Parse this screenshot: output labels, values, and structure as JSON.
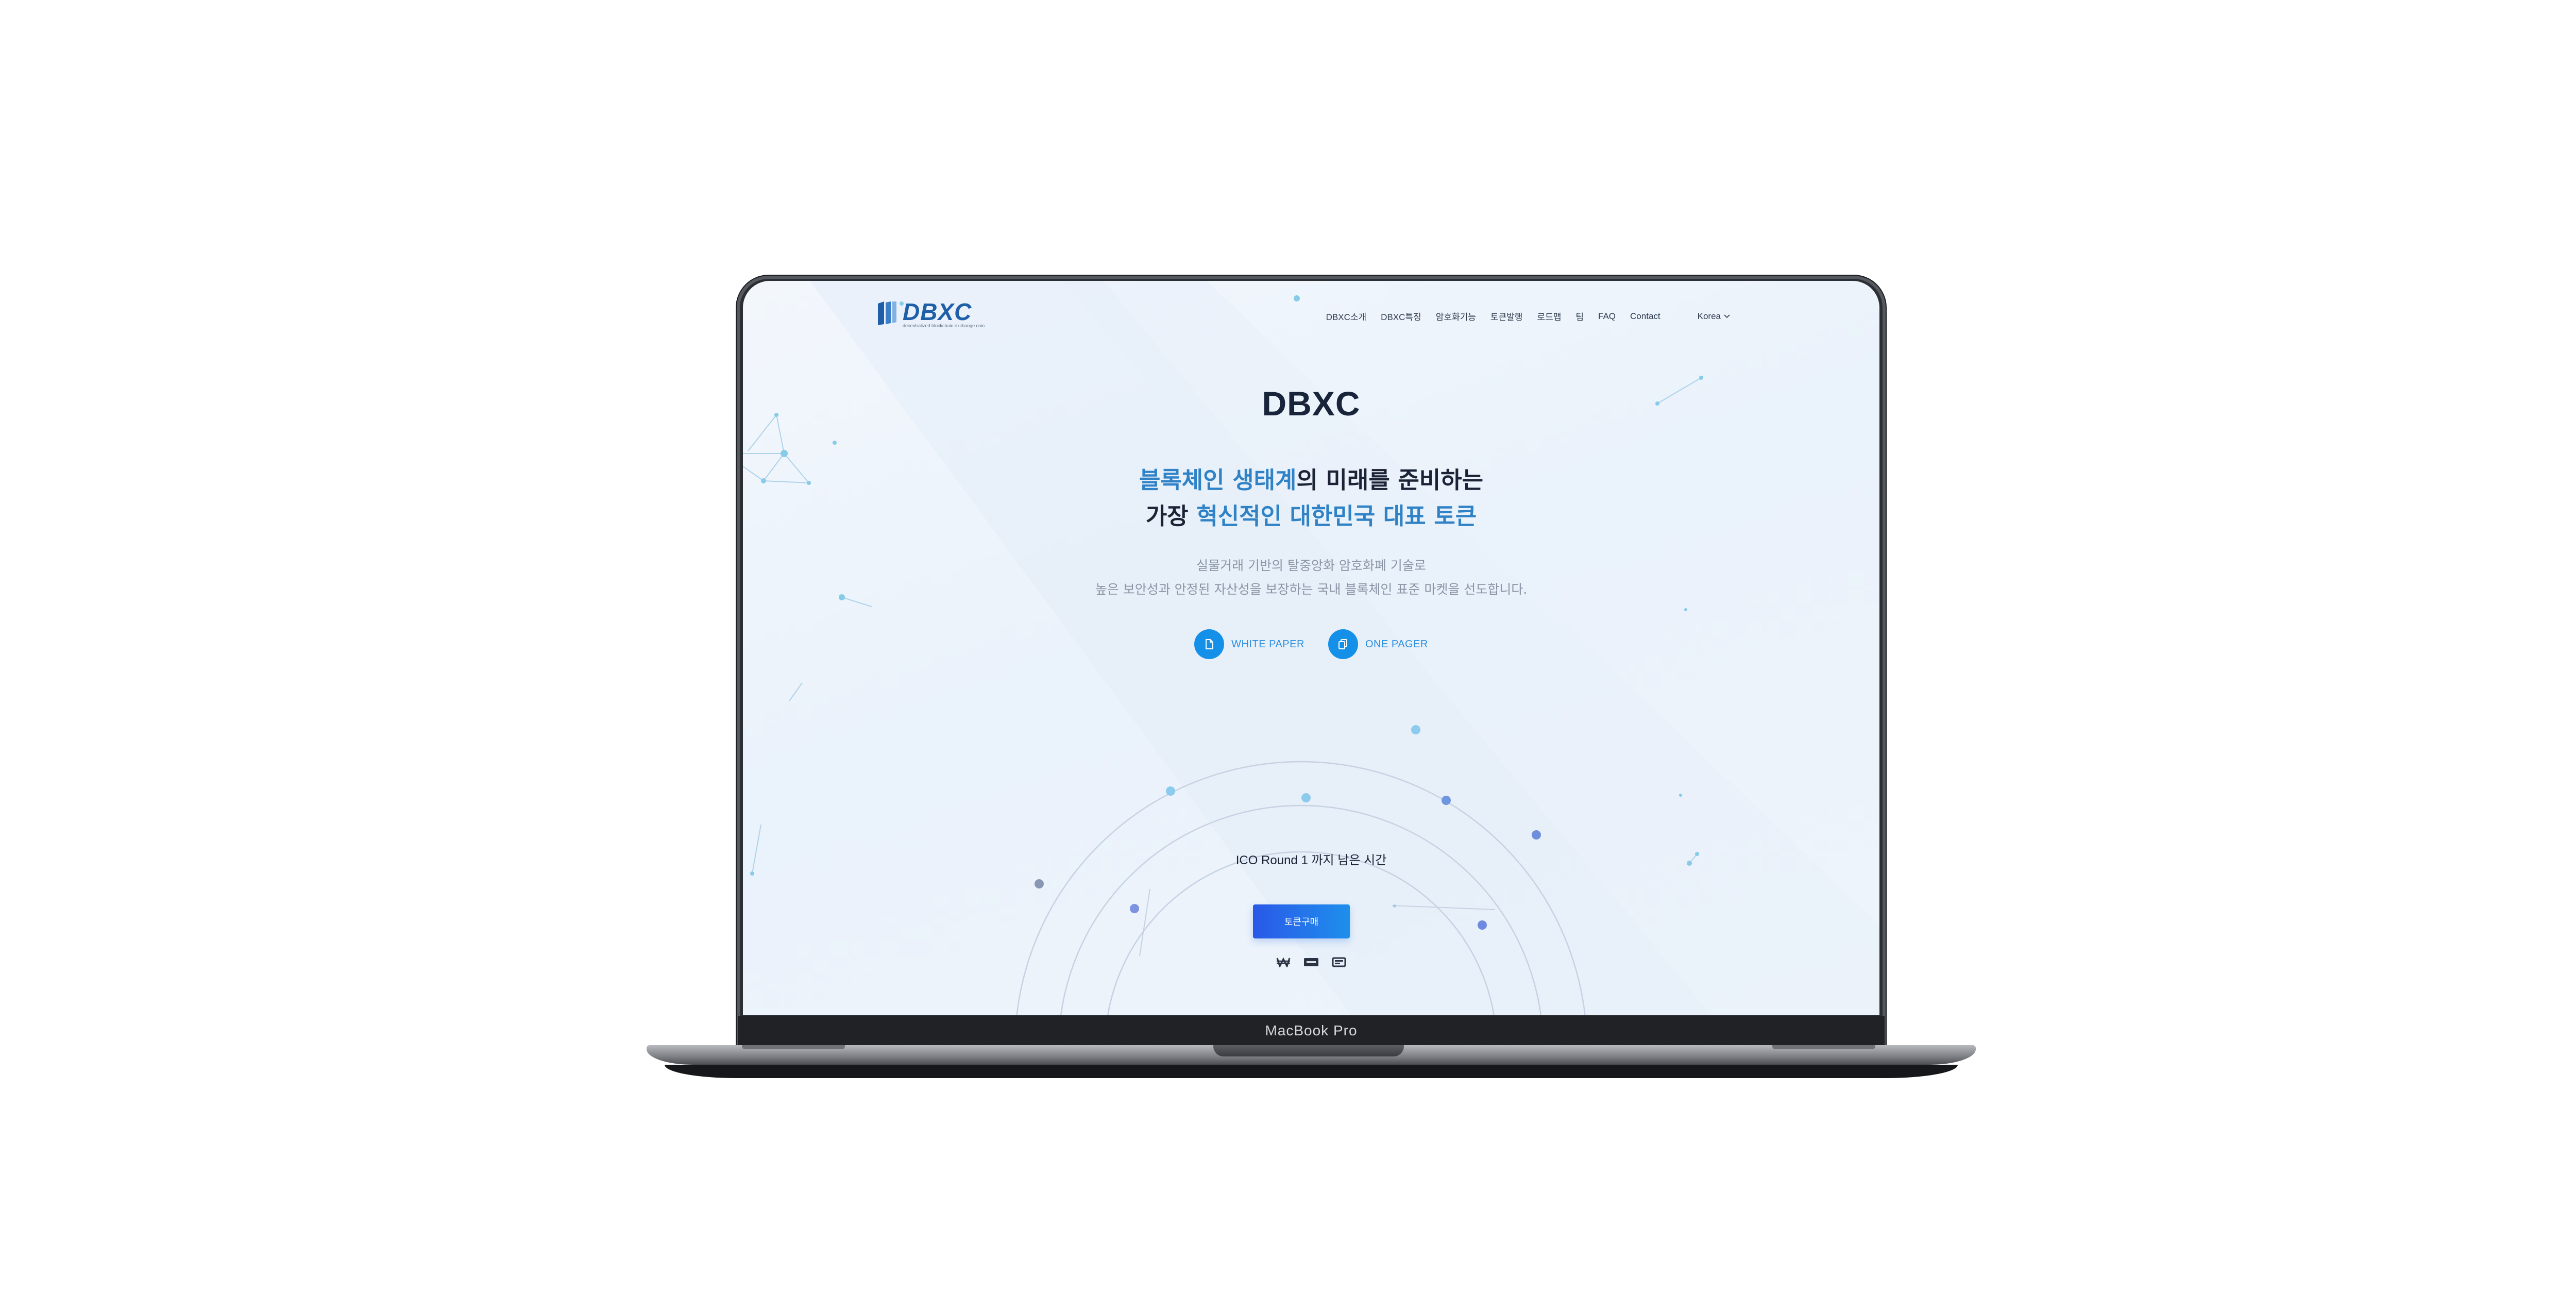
{
  "laptop": {
    "brand_label": "MacBook Pro"
  },
  "header": {
    "logo": {
      "name": "DBXC",
      "tagline": "decentralized blockchain exchange coin",
      "icon": "dbxc-logo-mark"
    },
    "nav": [
      {
        "label": "DBXC소개"
      },
      {
        "label": "DBXC특징"
      },
      {
        "label": "암호화기능"
      },
      {
        "label": "토큰발행"
      },
      {
        "label": "로드맵"
      },
      {
        "label": "팀"
      },
      {
        "label": "FAQ"
      },
      {
        "label": "Contact"
      }
    ],
    "language": {
      "label": "Korea",
      "icon": "chevron-down-icon"
    }
  },
  "hero": {
    "title": "DBXC",
    "headline_line1": {
      "highlight": "블록체인 생태계",
      "rest": "의 미래를 준비하는"
    },
    "headline_line2": {
      "prefix": "가장 ",
      "highlight": "혁신적인 대한민국 대표 토큰"
    },
    "description_line1": "실물거래 기반의 탈중앙화 암호화폐 기술로",
    "description_line2": "높은 보안성과 안정된 자산성을 보장하는 국내 블록체인 표준 마켓을 선도합니다.",
    "documents": [
      {
        "label": "WHITE PAPER",
        "icon": "document-icon"
      },
      {
        "label": "ONE PAGER",
        "icon": "copy-document-icon"
      }
    ]
  },
  "ico": {
    "countdown_label": "ICO Round 1 까지 남은 시간",
    "buy_button": "토큰구매",
    "payment_icons": [
      "won-icon",
      "visa-card-icon",
      "wallet-icon"
    ]
  },
  "colors": {
    "accent": "#2f82c6",
    "button_start": "#2a58e8",
    "button_end": "#1e8fec",
    "doc_circle": "#1590e8",
    "text_dark": "#1b2436"
  }
}
